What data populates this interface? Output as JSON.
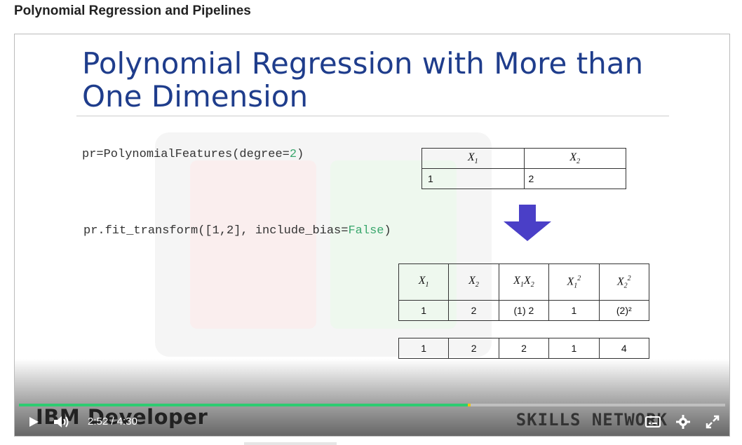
{
  "page": {
    "title": "Polynomial Regression and Pipelines"
  },
  "slide": {
    "title_line1": "Polynomial Regression with More than",
    "title_line2": "One Dimension",
    "code1": {
      "pre": "pr=PolynomialFeatures(degree=",
      "num": "2",
      "post": ")"
    },
    "code2": {
      "pre": "pr.fit_transform([1,2], include_bias=",
      "kw": "False",
      "post": ")"
    },
    "input_table": {
      "headers": [
        "X1",
        "X2"
      ],
      "values": [
        "1",
        "2"
      ]
    },
    "output_table": {
      "headers": [
        "X1",
        "X2",
        "X1X2",
        "X1^2",
        "X2^2"
      ],
      "expr_row": [
        "1",
        "2",
        "(1) 2",
        "1",
        "(2)²"
      ],
      "value_row": [
        "1",
        "2",
        "2",
        "1",
        "4"
      ]
    },
    "brand_left": "IBM Developer",
    "brand_right": "SKILLS NETWORK"
  },
  "player": {
    "current_time": "2:52",
    "separator": "/",
    "duration": "4:30",
    "progress_fraction": 0.636,
    "icons": [
      "play-icon",
      "volume-icon",
      "captions-icon",
      "settings-icon",
      "fullscreen-icon"
    ],
    "accent_color": "#2ecc71",
    "buffer_color": "#f1c40f"
  }
}
